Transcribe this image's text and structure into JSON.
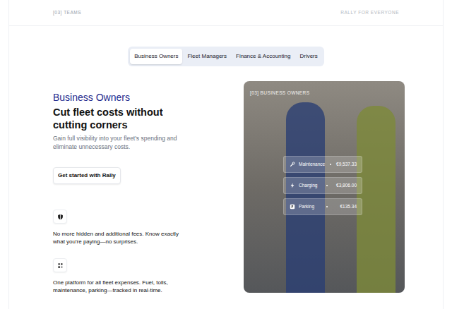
{
  "header": {
    "section": "[03] TEAMS",
    "tagline": "RALLY FOR EVERYONE"
  },
  "tabs": [
    {
      "label": "Business Owners",
      "selected": true
    },
    {
      "label": "Fleet Managers",
      "selected": false
    },
    {
      "label": "Finance & Accounting",
      "selected": false
    },
    {
      "label": "Drivers",
      "selected": false
    }
  ],
  "hero": {
    "eyebrow": "Business Owners",
    "title": "Cut fleet costs without cutting corners",
    "subtitle": "Gain full visibility into your fleet's spending and eliminate unnecessary costs.",
    "cta": "Get started with Rally"
  },
  "features": [
    {
      "kind": "shield",
      "text": "No more hidden and additional fees. Know exactly what you're paying—no surprises."
    },
    {
      "kind": "grid",
      "text": "One platform for all fleet expenses. Fuel, tolls, maintenance, parking—tracked in real-time."
    }
  ],
  "image": {
    "label": "[03] BUSINESS OWNERS",
    "expenses": [
      {
        "kind": "wrench",
        "label": "Maintenance",
        "amount": "€9,537.33"
      },
      {
        "kind": "bolt",
        "label": "Charging",
        "amount": "€3,806.00"
      },
      {
        "kind": "parking",
        "label": "Parking",
        "amount": "€135.34"
      }
    ]
  }
}
